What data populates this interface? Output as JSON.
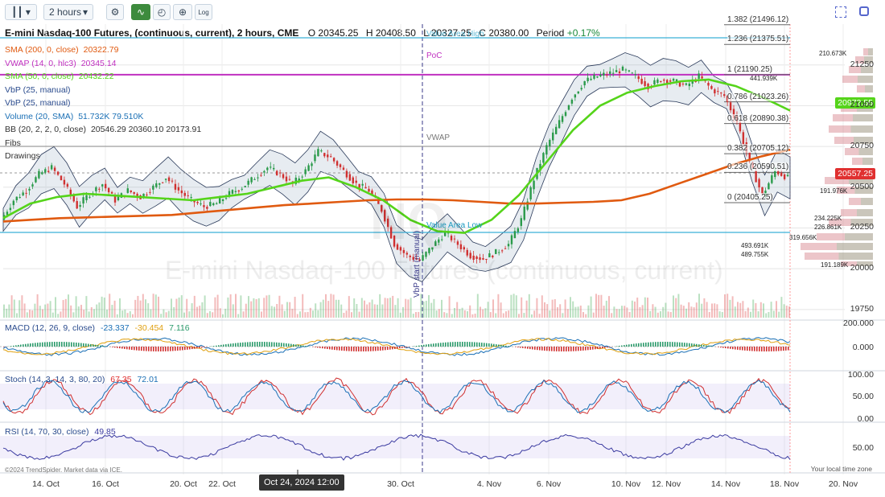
{
  "toolbar": {
    "chart_type_icon": "candle-icon",
    "interval_value": "2 hours",
    "buttons": [
      "gear-icon",
      "trend-icon",
      "clock-icon",
      "crosshair-icon",
      "log-icon"
    ],
    "log_label": "Log"
  },
  "header": {
    "symbol": "E-mini Nasdaq-100 Futures, (continuous, current), 2 hours, CME",
    "open_label": "O",
    "open": "20345.25",
    "high_label": "H",
    "high": "20408.50",
    "low_label": "L",
    "low": "20327.25",
    "close_label": "C",
    "close": "20380.00",
    "period_label": "Period",
    "period": "+0.17%"
  },
  "legend": [
    {
      "name": "SMA (200, 0, close)",
      "value": "20322.79",
      "color": "#e05a10"
    },
    {
      "name": "VWAP (14, 0, hlc3)",
      "value": "20345.14",
      "color": "#c030c0"
    },
    {
      "name": "SMA (50, 0, close)",
      "value": "20432.22",
      "color": "#55d41a"
    },
    {
      "name": "VbP (25, manual)",
      "value": "",
      "color": "#2a4b8d"
    },
    {
      "name": "VbP (25, manual)",
      "value": "",
      "color": "#2a4b8d"
    },
    {
      "name": "Volume (20, SMA)",
      "value": "51.732K 79.510K",
      "color": "#1a6fb5"
    },
    {
      "name": "BB (20, 2, 2, 0, close)",
      "value": "20546.29 20360.10 20173.91",
      "color": "#333"
    },
    {
      "name": "Fibs",
      "value": "",
      "color": "#333"
    },
    {
      "name": "Drawings",
      "value": "",
      "color": "#333"
    }
  ],
  "annotations": {
    "poc": "PoC",
    "vwap": "VWAP",
    "value_area_low": "Value Area Low",
    "value_area_high": "Value Area High",
    "vbp_start": "VbP start (manual)",
    "watermark_symbol": "NQ",
    "watermark_name": "E-mini Nasdaq-100 Futures (continuous, current)",
    "copyright": "©2024 TrendSpider. Market data via ICE.",
    "timezone": "Your local time zone",
    "crosshair_date": "Oct 24, 2024 12:00"
  },
  "fib_levels": [
    {
      "label": "1.382 (21496.12)",
      "price": 21496.12
    },
    {
      "label": "1.236 (21375.51)",
      "price": 21375.51
    },
    {
      "label": "1 (21190.25)",
      "price": 21190.25
    },
    {
      "label": "0.786 (21023.26)",
      "price": 21023.26
    },
    {
      "label": "0.618 (20890.38)",
      "price": 20890.38
    },
    {
      "label": "0.382 (20705.12)",
      "price": 20705.12
    },
    {
      "label": "0.236 (20590.51)",
      "price": 20590.51
    },
    {
      "label": "0 (20405.25)",
      "price": 20405.25
    }
  ],
  "vbp_labels": [
    "210.673K",
    "441.939K",
    "191.976K",
    "234.225K",
    "226.861K",
    "319.656K",
    "493.691K",
    "489.755K",
    "191.189K"
  ],
  "price_tags": {
    "sma50": "20972.55",
    "last": "20557.25",
    "sma50_color": "#55d41a",
    "last_color": "#e03030"
  },
  "macd_legend": {
    "name": "MACD (12, 26, 9, close)",
    "v1": "-23.337",
    "v2": "-30.454",
    "v3": "7.116"
  },
  "stoch_legend": {
    "name": "Stoch (14, 3, 14, 3, 80, 20)",
    "v1": "67.35",
    "v2": "72.01"
  },
  "rsi_legend": {
    "name": "RSI (14, 70, 30, close)",
    "v1": "49.85"
  },
  "chart_data": [
    {
      "type": "candlestick",
      "title": "E-mini Nasdaq-100 Futures, (continuous, current), 2 hours, CME",
      "x_ticks": [
        "14. Oct",
        "16. Oct",
        "20. Oct",
        "22. Oct",
        "30. Oct",
        "4. Nov",
        "6. Nov",
        "10. Nov",
        "12. Nov",
        "14. Nov",
        "18. Nov",
        "20. Nov"
      ],
      "y_ticks": [
        21250,
        21000,
        20750,
        20500,
        20250,
        20000,
        19750
      ],
      "ylim": [
        19700,
        21500
      ],
      "close_path": [
        20300,
        20420,
        20480,
        20580,
        20620,
        20520,
        20380,
        20460,
        20520,
        20420,
        20480,
        20440,
        20500,
        20560,
        20480,
        20420,
        20380,
        20400,
        20460,
        20500,
        20560,
        20620,
        20580,
        20520,
        20600,
        20720,
        20680,
        20600,
        20520,
        20480,
        20360,
        20150,
        20080,
        20050,
        20140,
        20220,
        20150,
        20080,
        20060,
        20100,
        20150,
        20300,
        20550,
        20750,
        20900,
        21050,
        21150,
        21180,
        21200,
        21220,
        21180,
        21120,
        21160,
        21150,
        21120,
        21180,
        21100,
        21060,
        20900,
        20650,
        20450,
        20600,
        20557
      ],
      "series": [
        {
          "name": "SMA (200, 0, close)",
          "values": [
            20290,
            20300,
            20310,
            20315,
            20320,
            20325,
            20330,
            20345,
            20360,
            20375,
            20390,
            20400,
            20410,
            20420,
            20425,
            20425,
            20420,
            20410,
            20400,
            20400,
            20405,
            20410,
            20420,
            20460,
            20520,
            20580,
            20640,
            20690,
            20730
          ]
        },
        {
          "name": "SMA (50, 0, close)",
          "values": [
            20310,
            20400,
            20440,
            20460,
            20450,
            20440,
            20430,
            20420,
            20440,
            20460,
            20500,
            20540,
            20560,
            20500,
            20420,
            20300,
            20230,
            20220,
            20300,
            20450,
            20650,
            20850,
            21000,
            21080,
            21120,
            21150,
            21160,
            21120,
            21050,
            20970
          ]
        },
        {
          "name": "VWAP (14, 0, hlc3)",
          "values": [
            21190,
            21190
          ]
        }
      ]
    }
  ]
}
